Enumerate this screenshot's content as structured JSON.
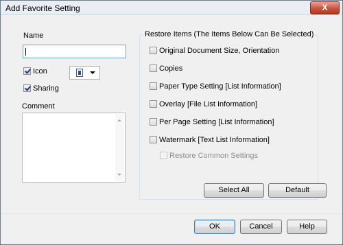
{
  "window": {
    "title": "Add Favorite Setting",
    "close_label": "X"
  },
  "left": {
    "name_label": "Name",
    "name_value": "",
    "icon_label": "Icon",
    "icon_checked": true,
    "sharing_label": "Sharing",
    "sharing_checked": true,
    "comment_label": "Comment",
    "comment_value": ""
  },
  "restore": {
    "title": "Restore Items (The Items Below Can Be Selected)",
    "items": [
      "Original Document Size, Orientation",
      "Copies",
      "Paper Type Setting [List Information]",
      "Overlay [File List Information]",
      "Per Page Setting [List Information]",
      "Watermark [Text List Information]"
    ],
    "sub_item": "Restore Common Settings",
    "select_all_label": "Select All",
    "default_label": "Default"
  },
  "footer": {
    "ok_label": "OK",
    "cancel_label": "Cancel",
    "help_label": "Help"
  }
}
